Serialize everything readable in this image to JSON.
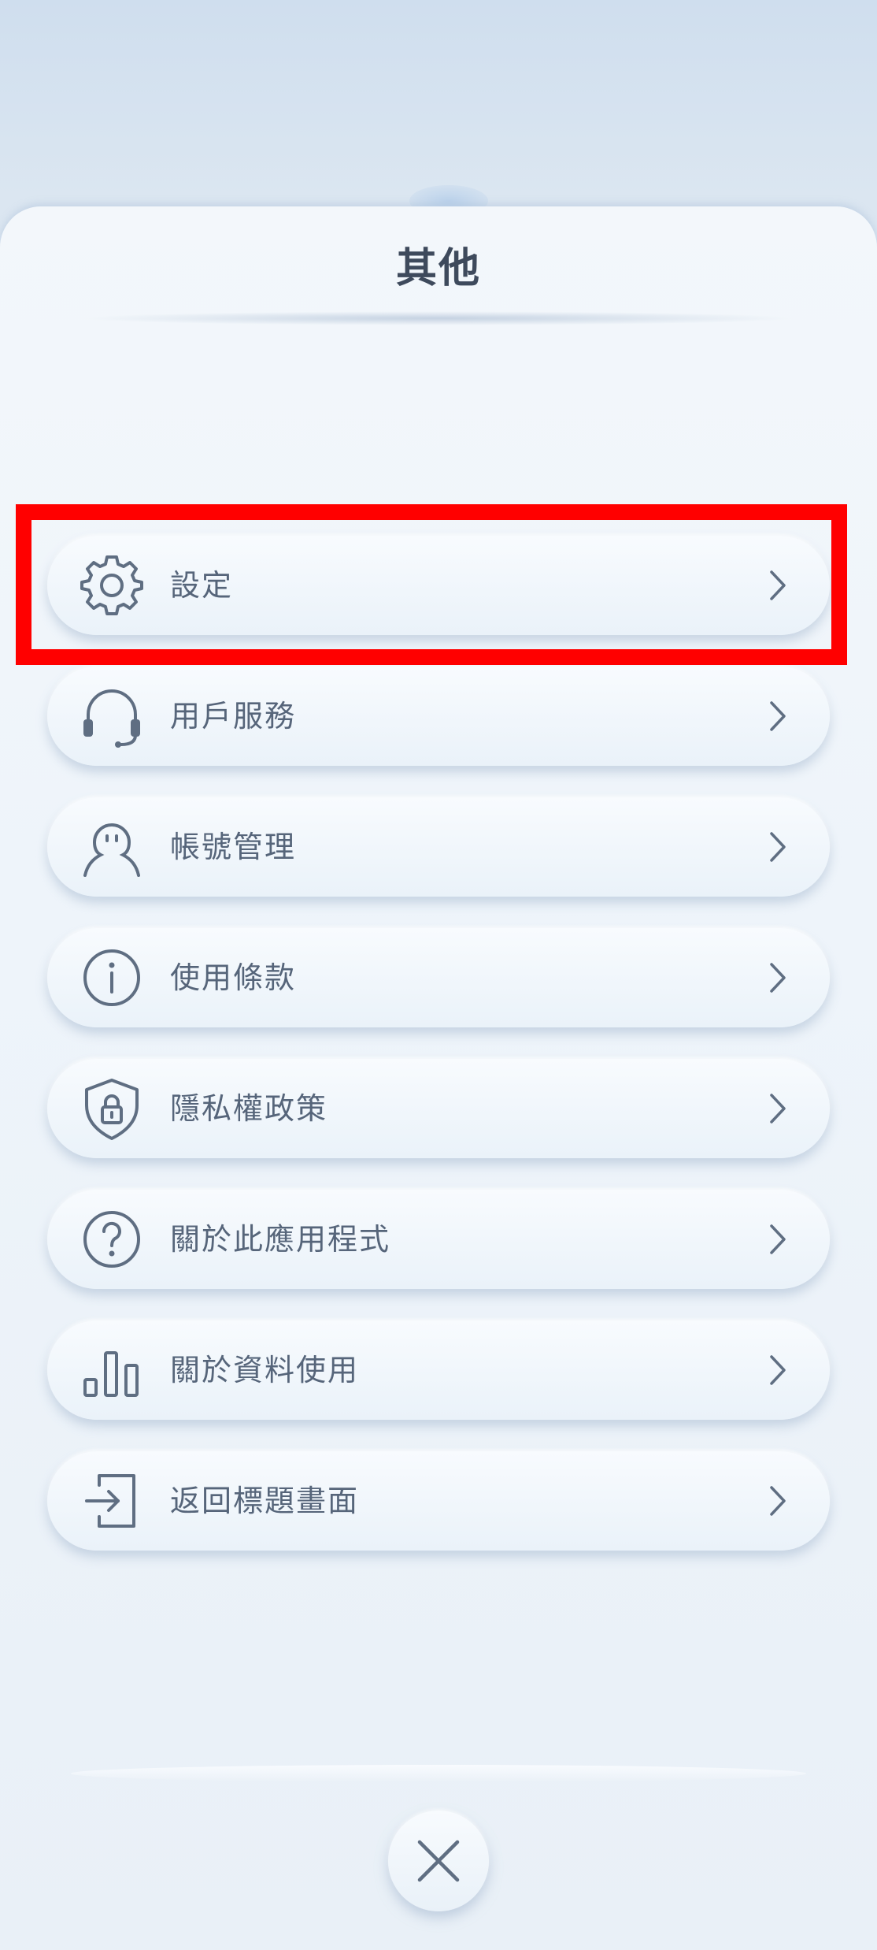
{
  "header": {
    "title": "其他"
  },
  "menu": {
    "items": [
      {
        "label": "設定",
        "icon": "gear-icon"
      },
      {
        "label": "用戶服務",
        "icon": "headset-icon"
      },
      {
        "label": "帳號管理",
        "icon": "user-icon"
      },
      {
        "label": "使用條款",
        "icon": "info-icon"
      },
      {
        "label": "隱私權政策",
        "icon": "shield-lock-icon"
      },
      {
        "label": "關於此應用程式",
        "icon": "question-icon"
      },
      {
        "label": "關於資料使用",
        "icon": "bar-chart-icon"
      },
      {
        "label": "返回標題畫面",
        "icon": "exit-icon"
      }
    ]
  },
  "footer": {
    "close_icon": "close-icon"
  },
  "colors": {
    "text": "#56657a",
    "title": "#3e4a5c",
    "highlight": "#ff0000",
    "icon": "#5f6e82"
  }
}
